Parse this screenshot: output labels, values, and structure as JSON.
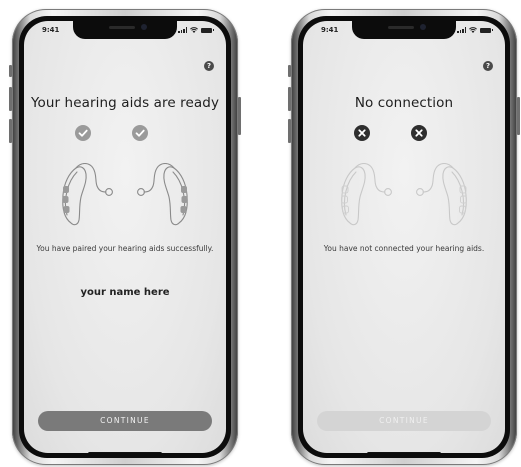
{
  "screens": [
    {
      "status_bar": {
        "time": "9:41"
      },
      "help_label": "?",
      "title": "Your hearing aids are ready",
      "left_status_icon": "check-icon",
      "right_status_icon": "check-icon",
      "message": "You have paired your hearing aids successfully.",
      "user_name": "your name here",
      "continue_label": "CONTINUE",
      "continue_enabled": true
    },
    {
      "status_bar": {
        "time": "9:41"
      },
      "help_label": "?",
      "title": "No connection",
      "left_status_icon": "x-icon",
      "right_status_icon": "x-icon",
      "message": "You have not connected your hearing aids.",
      "continue_label": "CONTINUE",
      "continue_enabled": false
    }
  ],
  "colors": {
    "check_badge": "#9a9a9a",
    "error_badge": "#2e2e2e",
    "button_enabled": "#7a7a7a",
    "button_disabled": "#d4d4d4",
    "aids_stroke_connected": "#8a8a8a",
    "aids_stroke_disconnected": "#c8c8c8"
  }
}
